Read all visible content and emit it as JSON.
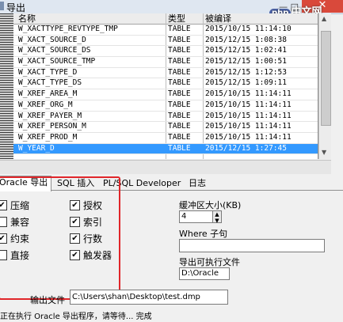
{
  "window": {
    "title": "导出",
    "min_max": "— □",
    "close": "✕"
  },
  "table": {
    "headers": {
      "name": "名称",
      "type": "类型",
      "compiled": "被编译"
    },
    "rows": [
      {
        "name": "W_XACTTYPE_REVTYPE_TMP",
        "type": "TABLE",
        "compiled": "2015/10/15 11:14:10"
      },
      {
        "name": "W_XACT_SOURCE_D",
        "type": "TABLE",
        "compiled": "2015/12/15 1:08:38"
      },
      {
        "name": "W_XACT_SOURCE_DS",
        "type": "TABLE",
        "compiled": "2015/12/15 1:02:41"
      },
      {
        "name": "W_XACT_SOURCE_TMP",
        "type": "TABLE",
        "compiled": "2015/12/15 1:00:51"
      },
      {
        "name": "W_XACT_TYPE_D",
        "type": "TABLE",
        "compiled": "2015/12/15 1:12:53"
      },
      {
        "name": "W_XACT_TYPE_DS",
        "type": "TABLE",
        "compiled": "2015/12/15 1:09:11"
      },
      {
        "name": "W_XREF_AREA_M",
        "type": "TABLE",
        "compiled": "2015/10/15 11:14:11"
      },
      {
        "name": "W_XREF_ORG_M",
        "type": "TABLE",
        "compiled": "2015/10/15 11:14:11"
      },
      {
        "name": "W_XREF_PAYER_M",
        "type": "TABLE",
        "compiled": "2015/10/15 11:14:11"
      },
      {
        "name": "W_XREF_PERSON_M",
        "type": "TABLE",
        "compiled": "2015/10/15 11:14:11"
      },
      {
        "name": "W_XREF_PROD_M",
        "type": "TABLE",
        "compiled": "2015/10/15 11:14:11"
      },
      {
        "name": "W_YEAR_D",
        "type": "TABLE",
        "compiled": "2015/12/15 1:27:45",
        "selected": true
      }
    ]
  },
  "tabs": [
    {
      "label": "Oracle 导出",
      "active": true
    },
    {
      "label": "SQL 插入"
    },
    {
      "label": "PL/SQL Developer"
    },
    {
      "label": "日志"
    }
  ],
  "options": {
    "compress": {
      "label": "压缩",
      "checked": true
    },
    "compatible": {
      "label": "兼容",
      "checked": false
    },
    "constraints": {
      "label": "约束",
      "checked": true
    },
    "direct": {
      "label": "直接",
      "checked": false
    },
    "grants": {
      "label": "授权",
      "checked": true
    },
    "indexes": {
      "label": "索引",
      "checked": true
    },
    "rows": {
      "label": "行数",
      "checked": true
    },
    "triggers": {
      "label": "触发器",
      "checked": true
    }
  },
  "buffer": {
    "label": "缓冲区大小(KB)",
    "value": "4"
  },
  "where": {
    "label": "Where 子句",
    "value": ""
  },
  "exporter": {
    "label": "导出可执行文件",
    "value": "D:\\Oracle"
  },
  "output": {
    "label": "输出文件",
    "value": "C:\\Users\\shan\\Desktop\\test.dmp"
  },
  "status": "正在执行 Oracle 导出程序，请等待... 完成",
  "watermark": {
    "badge": "php",
    "text": "中文网"
  }
}
